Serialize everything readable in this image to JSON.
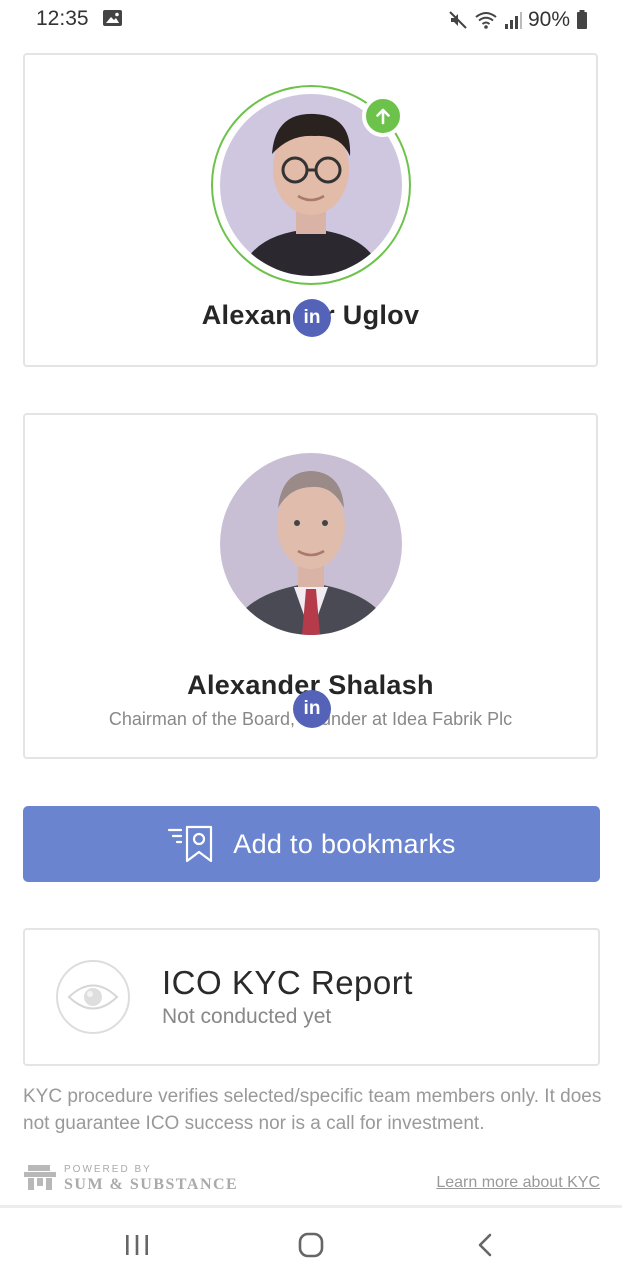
{
  "status_bar": {
    "time": "12:35",
    "battery": "90%"
  },
  "team": [
    {
      "name": "Alexander Uglov",
      "title": "",
      "linkedin_label": "in"
    },
    {
      "name": "Alexander Shalash",
      "title": "Chairman of the Board, Founder at Idea Fabrik Plc",
      "linkedin_label": "in"
    }
  ],
  "bookmark": {
    "label": "Add to bookmarks"
  },
  "kyc": {
    "title": "ICO KYC Report",
    "subtitle": "Not conducted yet",
    "disclaimer": "KYC procedure verifies selected/specific team members only. It does not guarantee ICO success nor is a call for investment."
  },
  "footer": {
    "powered_by": "POWERED BY",
    "brand": "SUM & SUBSTANCE",
    "learn_link": "Learn more about KYC"
  },
  "colors": {
    "accent_green": "#6cc24a",
    "linkedin_blue": "#5462b8",
    "button_blue": "#6a84d0"
  },
  "icons": [
    "image-icon",
    "mute-icon",
    "wifi-icon",
    "signal-icon",
    "battery-icon",
    "arrow-up-icon",
    "linkedin-icon",
    "bookmark-icon",
    "eye-icon",
    "sumsub-logo-icon",
    "recents-icon",
    "home-icon",
    "back-icon"
  ]
}
